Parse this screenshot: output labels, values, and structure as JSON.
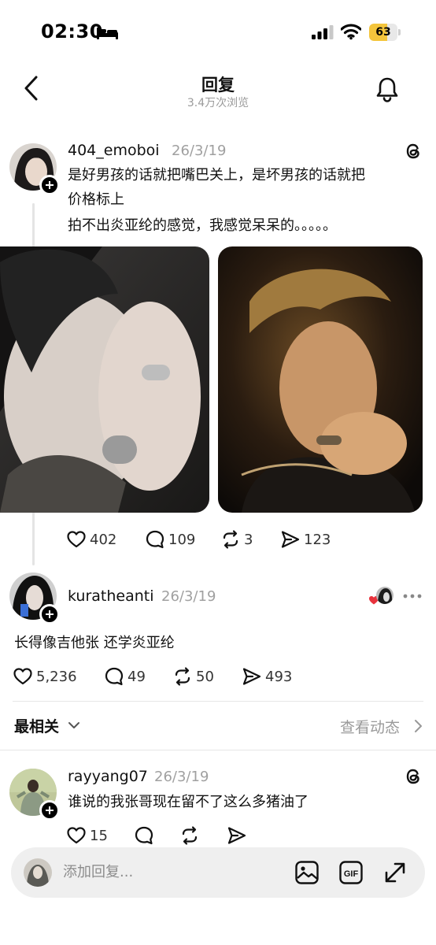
{
  "status_bar": {
    "time": "02:30",
    "battery": "63",
    "battery_fraction": 0.63,
    "icons": [
      "bed-icon",
      "signal-icon",
      "wifi-icon",
      "battery-icon"
    ]
  },
  "header": {
    "title": "回复",
    "subtitle": "3.4万次浏览",
    "icons": [
      "back-icon",
      "bell-icon"
    ]
  },
  "main_post": {
    "username": "404_emoboi",
    "date": "26/3/19",
    "text_lines": [
      "是好男孩的话就把嘴巴关上，是坏男孩的话就把",
      "价格标上",
      "拍不出炎亚纶的感觉，我感觉呆呆的。。。。。"
    ],
    "images": [
      "photo-1",
      "photo-2"
    ],
    "actions": {
      "likes": "402",
      "comments": "109",
      "reposts": "3",
      "shares": "123"
    }
  },
  "reply_post": {
    "username": "kuratheanti",
    "date": "26/3/19",
    "text": "长得像吉他张 还学炎亚纶",
    "actions": {
      "likes": "5,236",
      "comments": "49",
      "reposts": "50",
      "shares": "493"
    }
  },
  "sort_bar": {
    "label": "最相关",
    "activity_link": "查看动态"
  },
  "comment_post": {
    "username": "rayyang07",
    "date": "26/3/19",
    "text": "谁说的我张哥现在留不了这么多猪油了",
    "actions": {
      "likes": "15"
    }
  },
  "reply_bar": {
    "placeholder": "添加回复...",
    "gif_label": "GIF",
    "icons": [
      "image-icon",
      "gif-icon",
      "expand-icon"
    ]
  },
  "colors": {
    "battery_fill": "#f4c53c",
    "heart_red": "#e8323c",
    "muted_text": "#9a9a9a"
  }
}
